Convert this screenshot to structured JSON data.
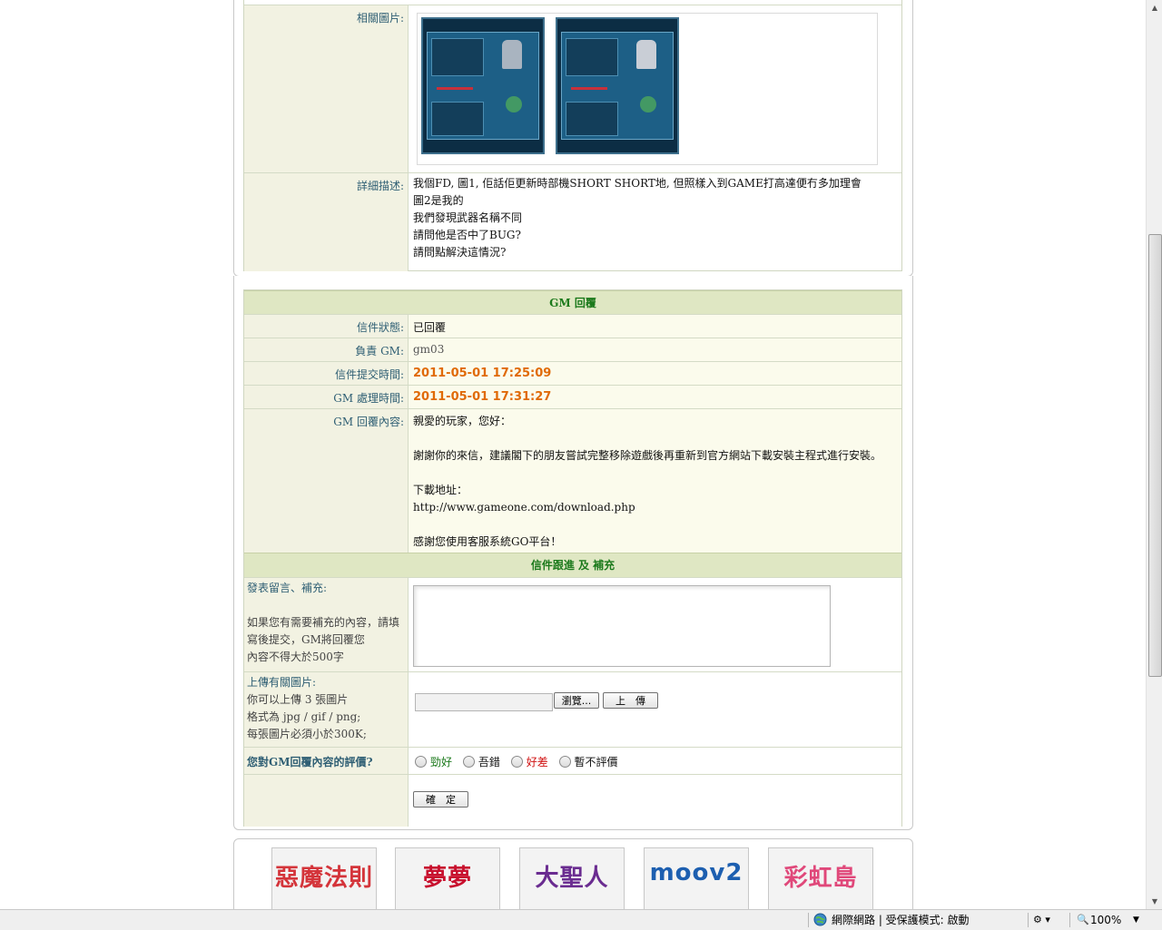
{
  "details": {
    "images_label": "相關圖片:",
    "description_label": "詳細描述:",
    "description_lines": [
      "我個FD, 圖1, 佢話佢更新時部機SHORT SHORT地, 但照樣入到GAME打高達便冇多加理會",
      "圖2是我的",
      "我們發現武器名稱不同",
      "請問他是否中了BUG?",
      "請問點解決這情況?"
    ]
  },
  "gm_reply": {
    "header": "GM 回覆",
    "status_label": "信件狀態:",
    "status_value": "已回覆",
    "gm_label": "負責 GM:",
    "gm_value": "gm03",
    "submit_time_label": "信件提交時間:",
    "submit_time_value": "2011-05-01 17:25:09",
    "process_time_label": "GM 處理時間:",
    "process_time_value": "2011-05-01 17:31:27",
    "content_label": "GM 回覆內容:",
    "content_greeting": "親愛的玩家，您好：",
    "content_body": "謝謝你的來信，建議閣下的朋友嘗試完整移除遊戲後再重新到官方網站下載安裝主程式進行安裝。",
    "download_label": "下載地址：",
    "download_url": "http://www.gameone.com/download.php",
    "thanks": "感謝您使用客服系統GO平台！"
  },
  "followup": {
    "header": "信件跟進 及 補充",
    "comment_label": "發表留言、補充:",
    "comment_hint_1": "如果您有需要補充的內容，請填",
    "comment_hint_2": "寫後提交，GM將回覆您",
    "comment_hint_3": "內容不得大於500字",
    "upload_label": "上傳有關圖片:",
    "upload_hint_1": "你可以上傳 3 張圖片",
    "upload_hint_2": "格式為 jpg / gif / png;",
    "upload_hint_3": "每張圖片必須小於300K;",
    "browse_button": "瀏覽...",
    "upload_button": "上　傳",
    "rating_label": "您對GM回覆內容的評價?",
    "rating_options": [
      "勁好",
      "吾錯",
      "好差",
      "暫不評價"
    ],
    "confirm_button": "確　定"
  },
  "banners": [
    "惡魔法則",
    "夢夢",
    "大聖人",
    "moov2",
    "彩虹島"
  ],
  "statusbar": {
    "zone": "網際網路 | 受保護模式: 啟動",
    "zoom": "100%"
  },
  "colors": {
    "accent_green": "#1c7a1c",
    "time_orange": "#e06a08",
    "label_teal": "#2f5f74"
  }
}
